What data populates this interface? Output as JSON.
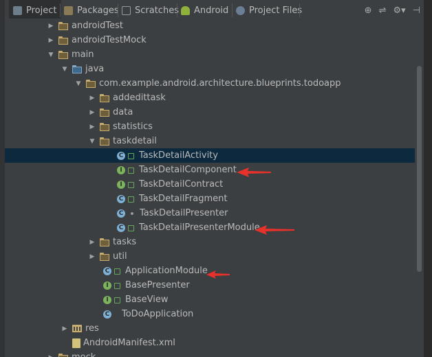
{
  "tabs": [
    {
      "label": "Project",
      "icon": "project-icon"
    },
    {
      "label": "Packages",
      "icon": "packages-icon"
    },
    {
      "label": "Scratches",
      "icon": "scratches-icon"
    },
    {
      "label": "Android",
      "icon": "android-icon"
    },
    {
      "label": "Project Files",
      "icon": "project-files-icon"
    }
  ],
  "toolbar": {
    "crosshair": "⊕",
    "collapse": "⇌",
    "gear": "⚙▾",
    "hide": "⊣"
  },
  "tree": {
    "rows": [
      {
        "label": "androidTest"
      },
      {
        "label": "androidTestMock"
      },
      {
        "label": "main"
      },
      {
        "label": "java"
      },
      {
        "label": "com.example.android.architecture.blueprints.todoapp"
      },
      {
        "label": "addedittask"
      },
      {
        "label": "data"
      },
      {
        "label": "statistics"
      },
      {
        "label": "taskdetail"
      },
      {
        "label": "TaskDetailActivity",
        "type": "class"
      },
      {
        "label": "TaskDetailComponent",
        "type": "interface"
      },
      {
        "label": "TaskDetailContract",
        "type": "interface"
      },
      {
        "label": "TaskDetailFragment",
        "type": "class"
      },
      {
        "label": "TaskDetailPresenter",
        "type": "class"
      },
      {
        "label": "TaskDetailPresenterModule",
        "type": "class"
      },
      {
        "label": "tasks"
      },
      {
        "label": "util"
      },
      {
        "label": "ApplicationModule",
        "type": "class"
      },
      {
        "label": "BasePresenter",
        "type": "interface"
      },
      {
        "label": "BaseView",
        "type": "interface"
      },
      {
        "label": "ToDoApplication",
        "type": "class"
      },
      {
        "label": "res"
      },
      {
        "label": "AndroidManifest.xml"
      },
      {
        "label": "mock"
      }
    ],
    "selected": "TaskDetailActivity"
  },
  "colors": {
    "background": "#3c3f41",
    "selection": "#0d293e",
    "annotation_arrow": "#e8312a"
  }
}
